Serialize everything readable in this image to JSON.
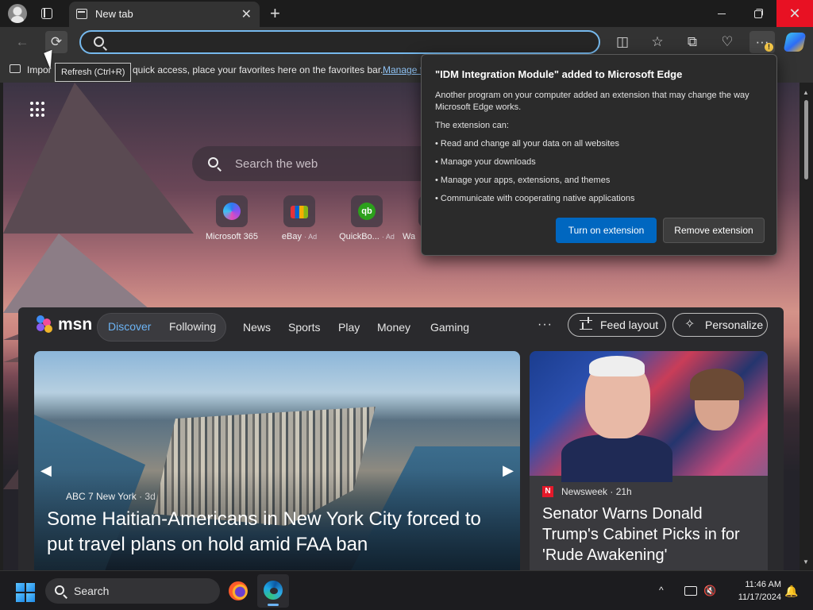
{
  "browser": {
    "tab_title": "New tab",
    "tab_close": "✕",
    "new_tab": "+",
    "window": {
      "minimize": "",
      "maximize": "",
      "close": "✕"
    },
    "address_bar": {
      "value": "",
      "placeholder": ""
    },
    "toolbar_icons": [
      "back-icon",
      "refresh-icon",
      "split-screen-icon",
      "favorites-icon",
      "collections-icon",
      "performance-icon",
      "more-icon",
      "copilot-icon"
    ],
    "tooltip": "Refresh (Ctrl+R)",
    "back_glyph": "←",
    "refresh_glyph": "⟳",
    "split_glyph": "◫",
    "fav_glyph": "☆",
    "coll_glyph": "⧉",
    "perf_glyph": "♡",
    "more_glyph": "···",
    "warn_glyph": "!"
  },
  "favorites_bar": {
    "import_label": "Impor",
    "message": "quick access, place your favorites here on the favorites bar.",
    "link": "Manage f"
  },
  "new_tab_page": {
    "search_placeholder": "Search the web",
    "sites": [
      {
        "label": "Microsoft 365",
        "ad": "",
        "icon": "microsoft-365-icon"
      },
      {
        "label": "eBay",
        "ad": "· Ad",
        "icon": "ebay-icon"
      },
      {
        "label": "QuickBo...",
        "ad": "· Ad",
        "icon": "quickbooks-icon",
        "logo_text": "qb"
      },
      {
        "label": "Wa",
        "ad": "",
        "icon": "site-icon"
      }
    ]
  },
  "feed": {
    "brand": "msn",
    "tabs": {
      "discover": "Discover",
      "following": "Following"
    },
    "nav": [
      "News",
      "Sports",
      "Play",
      "Money",
      "Gaming"
    ],
    "more": "···",
    "feed_layout": "Feed layout",
    "personalize": "Personalize",
    "main_story": {
      "source": "ABC 7 New York",
      "time": "· 3d",
      "title": "Some Haitian-Americans in New York City forced to put travel plans on hold amid FAA ban"
    },
    "side_story": {
      "source_logo": "N",
      "source": "Newsweek",
      "time": "· 21h",
      "title": "Senator Warns Donald Trump's Cabinet Picks in for 'Rude Awakening'"
    }
  },
  "popup": {
    "title": "\"IDM Integration Module\" added to Microsoft Edge",
    "description": "Another program on your computer added an extension that may change the way Microsoft Edge works.",
    "can_label": "The extension can:",
    "permissions": [
      "• Read and change all your data on all websites",
      "• Manage your downloads",
      "• Manage your apps, extensions, and themes",
      "• Communicate with cooperating native applications"
    ],
    "primary_button": "Turn on extension",
    "secondary_button": "Remove extension"
  },
  "taskbar": {
    "search_label": "Search",
    "time": "11:46 AM",
    "date": "11/17/2024",
    "chevron": "^",
    "bell": "🔔",
    "volume": "🔇"
  }
}
